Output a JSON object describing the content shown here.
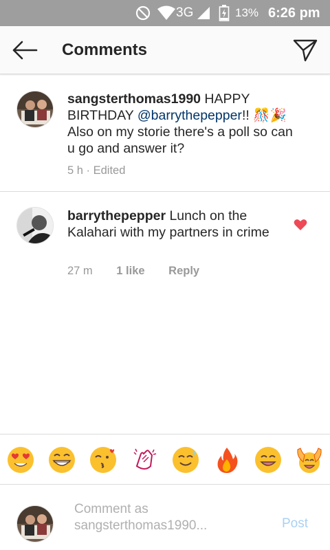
{
  "status_bar": {
    "network": "3G",
    "battery": "13%",
    "time": "6:26 pm",
    "icons": [
      "do-not-disturb-icon",
      "wifi-icon",
      "signal-icon",
      "battery-charging-icon"
    ]
  },
  "header": {
    "title": "Comments",
    "back_icon": "back-arrow-icon",
    "send_icon": "direct-send-icon"
  },
  "comments": [
    {
      "username": "sangsterthomas1990",
      "text_before": " HAPPY BIRTHDAY ",
      "mention": "@barrythepepper",
      "text_after": "!! 🎊🎉 Also on my storie there's a poll so can u go and answer it?",
      "time": "5 h",
      "edited": "· Edited"
    },
    {
      "username": "barrythepepper",
      "text": " Lunch on the Kalahari with my partners in crime",
      "time": "27 m",
      "likes": "1 like",
      "reply": "Reply",
      "liked": true,
      "heart_color": "#ed4956"
    }
  ],
  "emoji_bar": {
    "emojis": [
      "😍",
      "😂",
      "😘",
      "👏",
      "😊",
      "🔥",
      "😄",
      "🙌"
    ]
  },
  "composer": {
    "placeholder_line1": "Comment as",
    "placeholder_line2": "sangsterthomas1990...",
    "post_label": "Post"
  },
  "colors": {
    "mention": "#003569",
    "post_disabled": "#a9d1f3",
    "status_bar": "#9e9e9e"
  }
}
